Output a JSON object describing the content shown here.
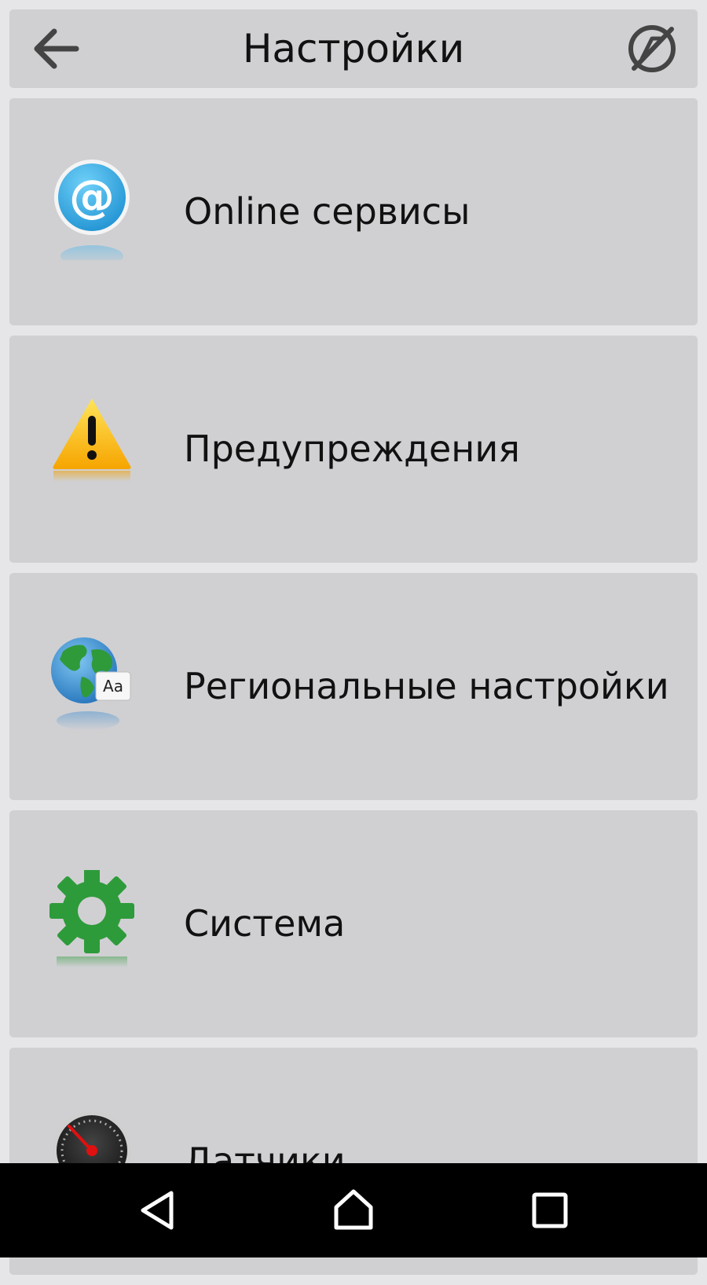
{
  "header": {
    "title": "Настройки",
    "back_icon": "arrow-left-icon",
    "action_icon": "map-off-icon"
  },
  "menu": {
    "items": [
      {
        "label": "Online сервисы",
        "icon": "at-sign-icon"
      },
      {
        "label": "Предупреждения",
        "icon": "warning-icon"
      },
      {
        "label": "Региональные настройки",
        "icon": "globe-language-icon"
      },
      {
        "label": "Система",
        "icon": "gear-icon"
      },
      {
        "label": "Датчики",
        "icon": "speedometer-icon"
      }
    ]
  },
  "colors": {
    "background": "#e6e6e8",
    "card": "#d0d0d3",
    "text": "#111111",
    "navbar": "#000000"
  },
  "navbar": {
    "buttons": [
      "back-triangle-icon",
      "home-icon",
      "recents-square-icon"
    ]
  }
}
